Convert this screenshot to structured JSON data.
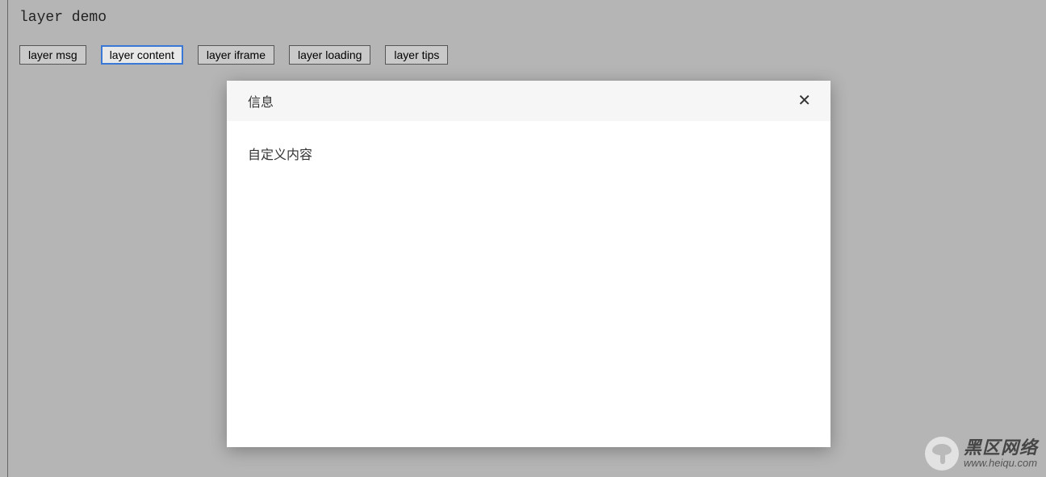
{
  "heading": "layer demo",
  "buttons": [
    {
      "label": "layer msg",
      "selected": false
    },
    {
      "label": "layer content",
      "selected": true
    },
    {
      "label": "layer iframe",
      "selected": false
    },
    {
      "label": "layer loading",
      "selected": false
    },
    {
      "label": "layer tips",
      "selected": false
    }
  ],
  "dialog": {
    "title": "信息",
    "body": "自定义内容"
  },
  "watermark": {
    "title": "黑区网络",
    "url": "www.heiqu.com"
  }
}
